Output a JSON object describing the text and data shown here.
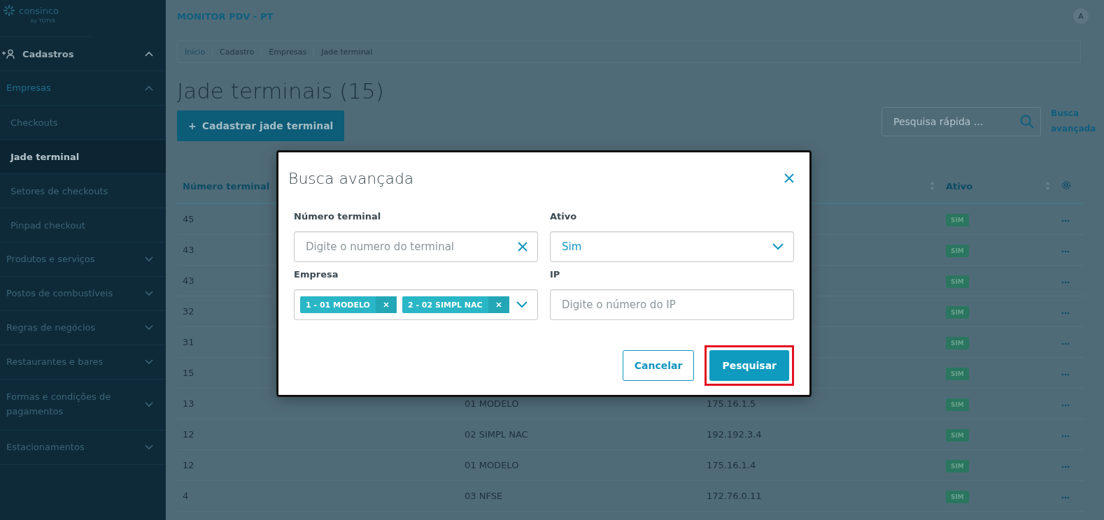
{
  "logo": {
    "name": "consinco",
    "by": "by",
    "brand": "TOTVS"
  },
  "sidebar": {
    "items": [
      {
        "label": "Cadastros",
        "kind": "section",
        "expanded": true,
        "children": [
          {
            "label": "Empresas",
            "kind": "group",
            "expanded": true,
            "children": [
              {
                "label": "Checkouts",
                "selected": false
              },
              {
                "label": "Jade terminal",
                "selected": true
              },
              {
                "label": "Setores de checkouts",
                "selected": false
              },
              {
                "label": "Pinpad checkout",
                "selected": false
              }
            ]
          },
          {
            "label": "Produtos e serviços",
            "kind": "group",
            "expanded": false
          },
          {
            "label": "Postos de combustíveis",
            "kind": "group",
            "expanded": false
          },
          {
            "label": "Regras de negócios",
            "kind": "group",
            "expanded": false
          },
          {
            "label": "Restaurantes e bares",
            "kind": "group",
            "expanded": false
          },
          {
            "label": "Formas e condições de pagamentos",
            "kind": "group",
            "expanded": false
          },
          {
            "label": "Estacionamentos",
            "kind": "group",
            "expanded": false
          }
        ]
      }
    ]
  },
  "header": {
    "title": "MONITOR PDV - PT",
    "avatar": "A"
  },
  "breadcrumbs": [
    "Início",
    "Cadastro",
    "Empresas",
    "Jade terminal"
  ],
  "page_title": "Jade terminais (15)",
  "add_button": "Cadastrar jade terminal",
  "add_button_icon": "+",
  "search": {
    "placeholder": "Pesquisa rápida ..."
  },
  "advanced_link": "Busca avançada",
  "table": {
    "columns": [
      {
        "label": "Número terminal"
      },
      {},
      {
        "sortable": true
      },
      {
        "label": "Ativo",
        "sortable": true
      }
    ],
    "rows": [
      {
        "numero": "45",
        "ativo": "SIM"
      },
      {
        "numero": "43",
        "ativo": "SIM"
      },
      {
        "numero": "43",
        "ativo": "SIM"
      },
      {
        "numero": "32",
        "ativo": "SIM"
      },
      {
        "numero": "31",
        "ativo": "SIM"
      },
      {
        "numero": "15",
        "ativo": "SIM"
      },
      {
        "numero": "13",
        "empresa": "01 MODELO",
        "ip": "175.16.1.5",
        "ativo": "SIM"
      },
      {
        "numero": "12",
        "empresa": "02 SIMPL NAC",
        "ip": "192.192.3.4",
        "ativo": "SIM"
      },
      {
        "numero": "12",
        "empresa": "01 MODELO",
        "ip": "175.16.1.4",
        "ativo": "SIM"
      },
      {
        "numero": "4",
        "empresa": "03 NFSE",
        "ip": "172.76.0.11",
        "ativo": "SIM"
      }
    ]
  },
  "modal": {
    "title": "Busca avançada",
    "fields": [
      {
        "kind": "input",
        "label": "Número terminal",
        "placeholder": "Digite o numero do terminal",
        "clearable": true
      },
      {
        "kind": "select",
        "label": "Ativo",
        "value": "Sim"
      },
      {
        "kind": "multiselect",
        "label": "Empresa",
        "tags": [
          "1 - 01 MODELO",
          "2 - 02 SIMPL NAC"
        ]
      },
      {
        "kind": "input",
        "label": "IP",
        "placeholder": "Digite o número do IP",
        "clearable": false
      }
    ],
    "buttons": [
      {
        "label": "Cancelar",
        "kind": "secondary",
        "highlighted": false
      },
      {
        "label": "Pesquisar",
        "kind": "primary",
        "highlighted": true
      }
    ]
  }
}
